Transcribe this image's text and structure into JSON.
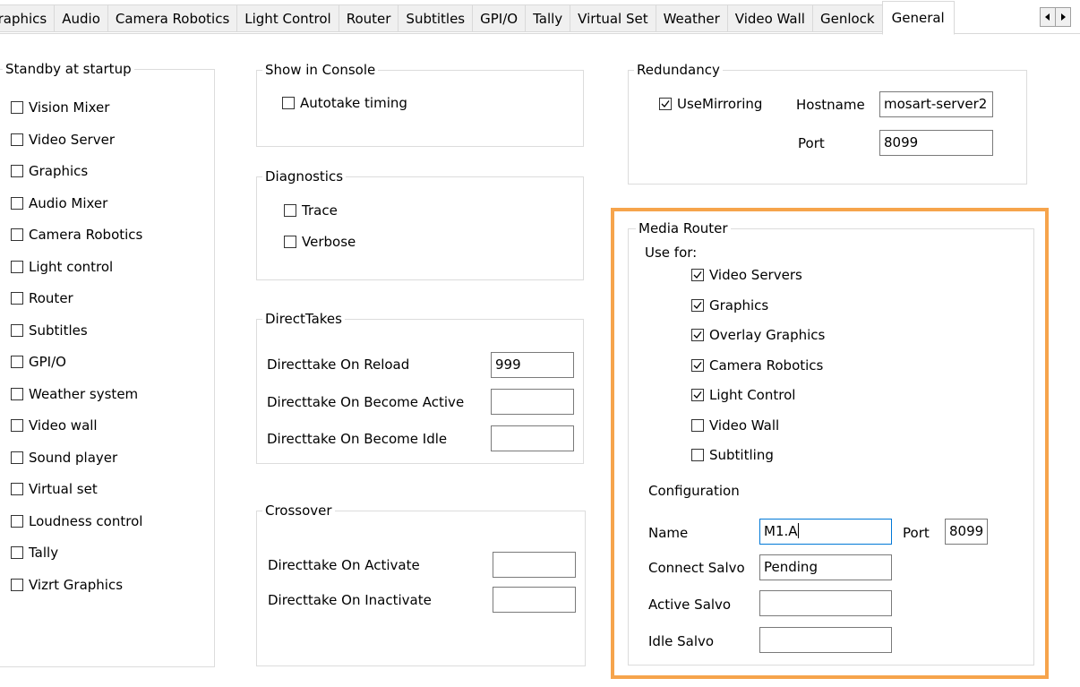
{
  "tabs": [
    "Graphics",
    "Audio",
    "Camera Robotics",
    "Light Control",
    "Router",
    "Subtitles",
    "GPI/O",
    "Tally",
    "Virtual Set",
    "Weather",
    "Video Wall",
    "Genlock",
    "General"
  ],
  "active_tab": "General",
  "standby": {
    "title": "Standby at startup",
    "items": [
      {
        "label": "Vision Mixer",
        "checked": false
      },
      {
        "label": "Video Server",
        "checked": false
      },
      {
        "label": "Graphics",
        "checked": false
      },
      {
        "label": "Audio Mixer",
        "checked": false
      },
      {
        "label": "Camera Robotics",
        "checked": false
      },
      {
        "label": "Light control",
        "checked": false
      },
      {
        "label": "Router",
        "checked": false
      },
      {
        "label": "Subtitles",
        "checked": false
      },
      {
        "label": "GPI/O",
        "checked": false
      },
      {
        "label": "Weather system",
        "checked": false
      },
      {
        "label": "Video wall",
        "checked": false
      },
      {
        "label": "Sound player",
        "checked": false
      },
      {
        "label": "Virtual set",
        "checked": false
      },
      {
        "label": "Loudness control",
        "checked": false
      },
      {
        "label": "Tally",
        "checked": false
      },
      {
        "label": "Vizrt Graphics",
        "checked": false
      }
    ]
  },
  "show_in_console": {
    "title": "Show in Console",
    "autotake_label": "Autotake timing",
    "autotake_checked": false
  },
  "diagnostics": {
    "title": "Diagnostics",
    "trace_label": "Trace",
    "verbose_label": "Verbose"
  },
  "direct_takes": {
    "title": "DirectTakes",
    "on_reload_label": "Directtake On Reload",
    "on_reload_value": "999",
    "on_become_active_label": "Directtake On Become Active",
    "on_become_active_value": "",
    "on_become_idle_label": "Directtake On Become Idle",
    "on_become_idle_value": ""
  },
  "crossover": {
    "title": "Crossover",
    "on_activate_label": "Directtake On Activate",
    "on_activate_value": "",
    "on_inactivate_label": "Directtake On Inactivate",
    "on_inactivate_value": ""
  },
  "redundancy": {
    "title": "Redundancy",
    "mirroring_label": "UseMirroring",
    "mirroring_checked": true,
    "hostname_label": "Hostname",
    "hostname_value": "mosart-server2",
    "port_label": "Port",
    "port_value": "8099"
  },
  "media_router": {
    "title": "Media Router",
    "use_for_label": "Use for:",
    "use_for": [
      {
        "label": "Video Servers",
        "checked": true
      },
      {
        "label": "Graphics",
        "checked": true
      },
      {
        "label": "Overlay Graphics",
        "checked": true
      },
      {
        "label": "Camera Robotics",
        "checked": true
      },
      {
        "label": "Light Control",
        "checked": true
      },
      {
        "label": "Video Wall",
        "checked": false
      },
      {
        "label": "Subtitling",
        "checked": false
      }
    ],
    "configuration_label": "Configuration",
    "name_label": "Name",
    "name_value": "M1.A",
    "port_label": "Port",
    "port_value": "8099",
    "connect_salvo_label": "Connect Salvo",
    "connect_salvo_value": "Pending",
    "active_salvo_label": "Active Salvo",
    "active_salvo_value": "",
    "idle_salvo_label": "Idle Salvo",
    "idle_salvo_value": ""
  },
  "colors": {
    "highlight": "#f6a44c",
    "focus_border": "#0078d7"
  }
}
